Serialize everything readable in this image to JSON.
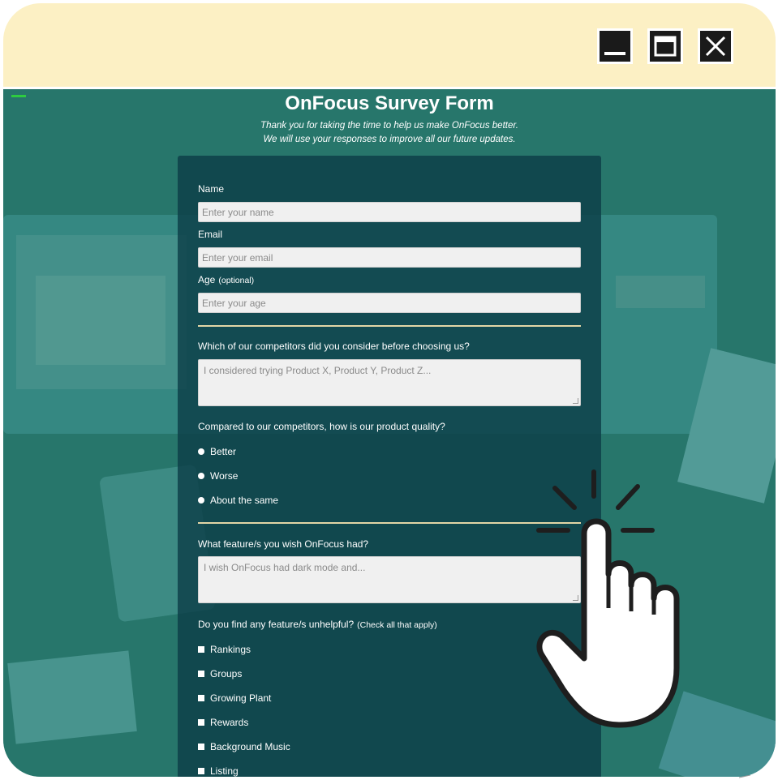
{
  "window": {
    "minimize_icon": "minimize-icon",
    "maximize_icon": "maximize-icon",
    "close_icon": "close-icon"
  },
  "page": {
    "title": "OnFocus Survey Form",
    "description_line1": "Thank you for taking the time to help us make OnFocus better.",
    "description_line2": "We will use your responses to improve all our future updates."
  },
  "form": {
    "name_label": "Name",
    "name_placeholder": "Enter your name",
    "email_label": "Email",
    "email_placeholder": "Enter your email",
    "age_label": "Age",
    "age_optional": "(optional)",
    "age_placeholder": "Enter your age",
    "competitors_question": "Which of our competitors did you consider before choosing us?",
    "competitors_placeholder": "I considered trying Product X, Product Y, Product Z...",
    "quality_question": "Compared to our competitors, how is our product quality?",
    "quality_options": [
      "Better",
      "Worse",
      "About the same"
    ],
    "wish_question": "What feature/s you wish OnFocus had?",
    "wish_placeholder": "I wish OnFocus had dark mode and...",
    "unhelpful_question": "Do you find any feature/s unhelpful?",
    "unhelpful_note": "(Check all that apply)",
    "unhelpful_options": [
      "Rankings",
      "Groups",
      "Growing Plant",
      "Rewards",
      "Background Music",
      "Listing"
    ]
  },
  "colors": {
    "titlebar": "#fcf0c4",
    "background": "#2f7e73",
    "form_panel": "#0c3e48",
    "divider": "#e2d6a6",
    "input": "#f0f0f0"
  },
  "decorations": {
    "pointer": "hand-pointer-icon"
  }
}
